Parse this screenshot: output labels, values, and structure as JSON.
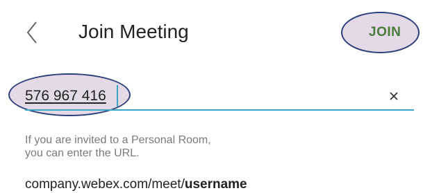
{
  "header": {
    "back_icon": "chevron-left-icon",
    "title": "Join Meeting",
    "join_label": "JOIN",
    "join_color": "#4a7a3c"
  },
  "meeting_input": {
    "value": "576 967 416",
    "clear_icon": "close-icon",
    "accent_color": "#3aa6c7"
  },
  "helper": {
    "line1": "If you are invited to a Personal Room,",
    "line2": "you can enter the URL."
  },
  "url_example": {
    "prefix": "company.webex.com/meet/",
    "username": "username"
  },
  "annotations": {
    "highlight_color": "#c4aac8",
    "outline_color": "#2b3f7a"
  }
}
